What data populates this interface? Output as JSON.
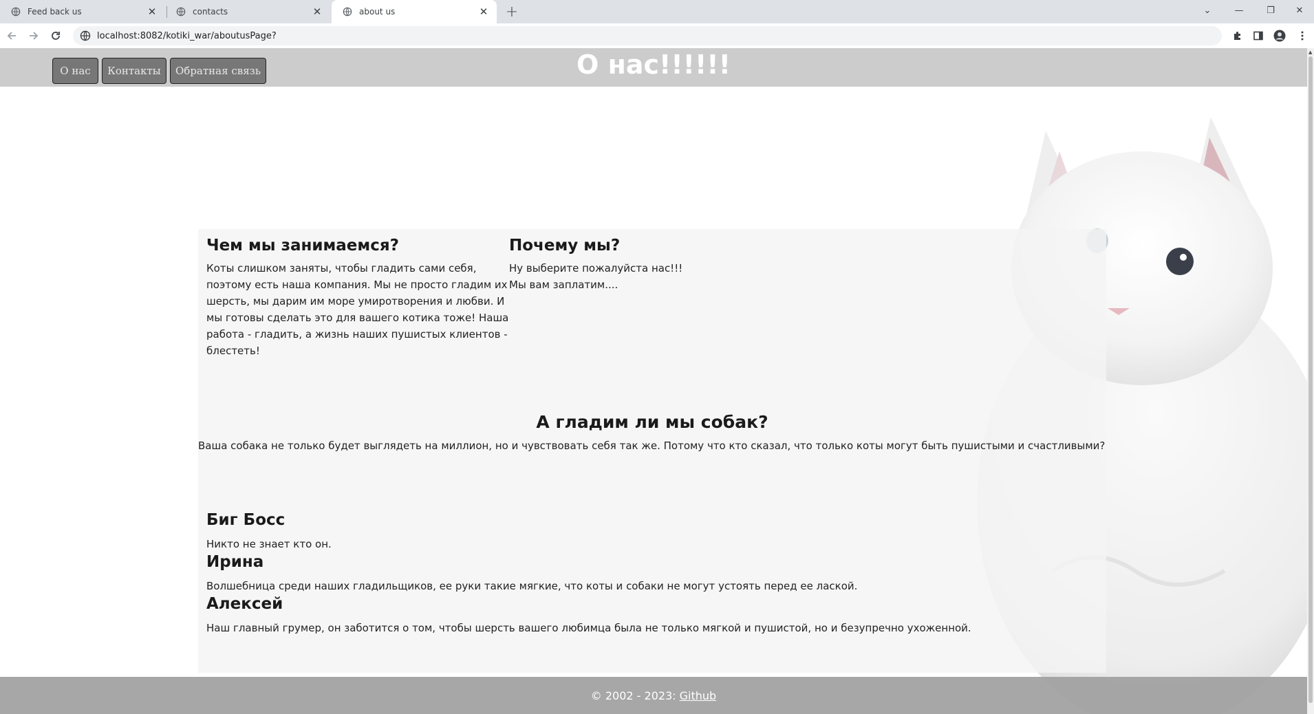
{
  "browser": {
    "tabs": [
      {
        "title": "Feed back us",
        "active": false
      },
      {
        "title": "contacts",
        "active": false
      },
      {
        "title": "about us",
        "active": true
      }
    ],
    "url": "localhost:8082/kotiki_war/aboutusPage?"
  },
  "header": {
    "nav": [
      "О нас",
      "Контакты",
      "Обратная связь"
    ],
    "title": "О нас!!!!!!"
  },
  "sections": {
    "what": {
      "heading": "Чем мы занимаемся?",
      "lines": [
        "Коты слишком заняты, чтобы гладить сами себя,",
        "поэтому есть наша компания. Мы не просто гладим их",
        "шерсть, мы дарим им море умиротворения и любви. И",
        "мы готовы сделать это для вашего котика тоже! Наша",
        "работа - гладить, а жизнь наших пушистых клиентов -",
        "блестеть!"
      ]
    },
    "why": {
      "heading": "Почему мы?",
      "lines": [
        "Ну выберите пожалуйста нас!!!",
        "Мы вам заплатим...."
      ]
    },
    "dogs": {
      "heading": "А гладим ли мы собак?",
      "text": "Ваша собака не только будет выглядеть на миллион, но и чувствовать себя так же. Потому что кто сказал, что только коты могут быть пушистыми и счастливыми?"
    },
    "staff": [
      {
        "name": "Биг Босс",
        "desc": "Никто не знает кто он."
      },
      {
        "name": "Ирина",
        "desc": "Волшебница среди наших гладильщиков, ее руки такие мягкие, что коты и собаки не могут устоять перед ее лаской."
      },
      {
        "name": "Алексей",
        "desc": "Наш главный грумер, он заботится о том, чтобы шерсть вашего любимца была не только мягкой и пушистой, но и безупречно ухоженной."
      }
    ]
  },
  "footer": {
    "text": "© 2002 - 2023:",
    "link": "Github"
  }
}
